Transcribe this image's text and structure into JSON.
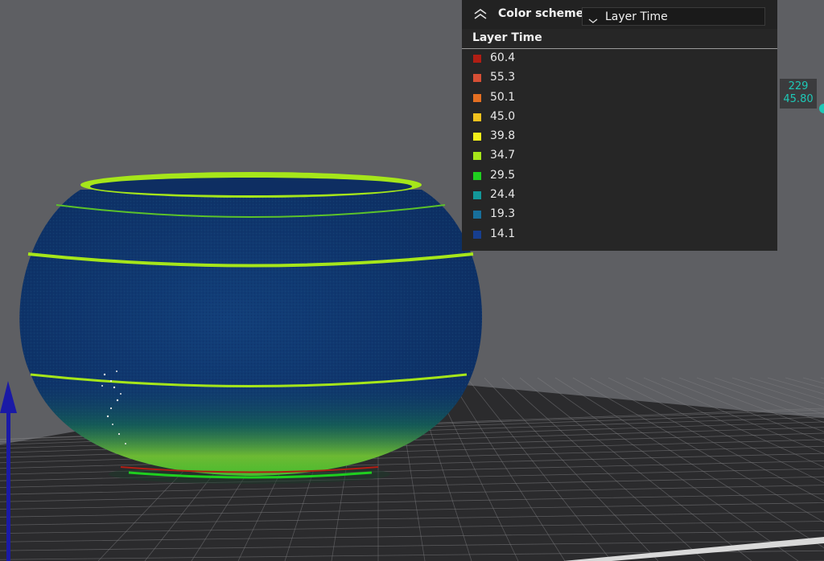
{
  "colors": {
    "background": "#5e5f63",
    "bed": "#2b2b2d",
    "grid_line": "#808083",
    "object_body": "#113a73",
    "stripe": "#a6e61a",
    "axis_z": "#1a1aa6",
    "accent_teal": "#1ec9b7"
  },
  "color_scheme": {
    "label": "Color scheme",
    "collapse_icon": "double-chevron-up-icon",
    "dropdown_icon": "chevron-down-icon",
    "selected": "Layer Time"
  },
  "legend": {
    "title": "Layer Time",
    "items": [
      {
        "value": "60.4",
        "color": "#b01e14"
      },
      {
        "value": "55.3",
        "color": "#d64f35"
      },
      {
        "value": "50.1",
        "color": "#e46f22"
      },
      {
        "value": "45.0",
        "color": "#f0c21e"
      },
      {
        "value": "39.8",
        "color": "#f2ef1a"
      },
      {
        "value": "34.7",
        "color": "#a6e61a"
      },
      {
        "value": "29.5",
        "color": "#1fcf1f"
      },
      {
        "value": "24.4",
        "color": "#13989a"
      },
      {
        "value": "19.3",
        "color": "#186f9b"
      },
      {
        "value": "14.1",
        "color": "#173e8f"
      }
    ]
  },
  "layer_slider": {
    "layer_number": "229",
    "height": "45.80"
  }
}
